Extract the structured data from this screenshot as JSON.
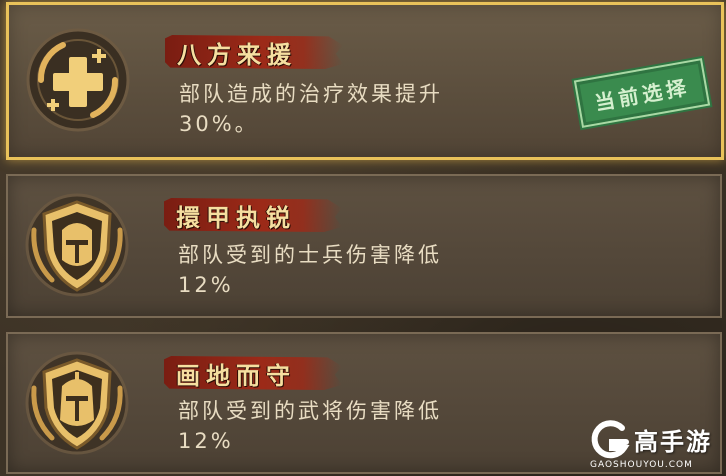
{
  "options": [
    {
      "name": "八方来援",
      "description_line1": "部队造成的治疗效果提升",
      "description_line2": "30%。",
      "icon": "heal-cross-icon",
      "selected": true
    },
    {
      "name": "擐甲执锐",
      "description_line1": "部队受到的士兵伤害降低",
      "description_line2": "12%",
      "icon": "helmet-shield-icon",
      "selected": false
    },
    {
      "name": "画地而守",
      "description_line1": "部队受到的武将伤害降低",
      "description_line2": "12%",
      "icon": "helmet-shield-icon",
      "selected": false
    }
  ],
  "stamp_label": "当前选择",
  "watermark": {
    "title": "高手游",
    "subtitle": "GAOSHOUYOU.COM"
  },
  "colors": {
    "selected_border": "#e9c25a",
    "name_banner": "#9c2a18",
    "stamp_green": "#3a8b4e",
    "text": "#e8dcc2"
  }
}
